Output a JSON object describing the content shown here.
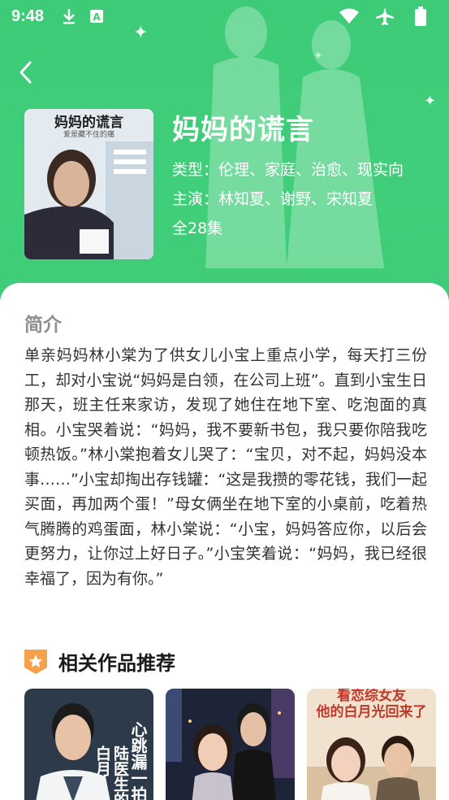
{
  "status_bar": {
    "time": "9:48",
    "left_icons": [
      "download-icon",
      "app-a-icon"
    ],
    "right_icons": [
      "wifi-icon",
      "airplane-icon",
      "battery-icon"
    ]
  },
  "header": {
    "back_icon": "chevron-left-icon"
  },
  "drama": {
    "title": "妈妈的谎言",
    "genre": "类型：伦理、家庭、治愈、现实向",
    "cast": "主演：林知夏、谢野、宋知夏",
    "episodes": "全28集",
    "poster": {
      "title": "妈妈的谎言",
      "subtitle": "爱是藏不住的痛"
    }
  },
  "synopsis": {
    "heading": "简介",
    "text": "单亲妈妈林小棠为了供女儿小宝上重点小学，每天打三份工，却对小宝说“妈妈是白领，在公司上班”。直到小宝生日那天，班主任来家访，发现了她住在地下室、吃泡面的真相。小宝哭着说：“妈妈，我不要新书包，我只要你陪我吃顿热饭。”林小棠抱着女儿哭了：“宝贝，对不起，妈妈没本事……”小宝却掏出存钱罐：“这是我攒的零花钱，我们一起买面，再加两个蛋！”母女俩坐在地下室的小桌前，吃着热气腾腾的鸡蛋面，林小棠说：“小宝，妈妈答应你，以后会更努力，让你过上好日子。”小宝笑着说：“妈妈，我已经很幸福了，因为有你。”"
  },
  "recommendations": {
    "heading": "相关作品推荐",
    "badge_icon": "star-badge-icon",
    "items": [
      {
        "overlay_text": "心跳漏一拍",
        "overlay_text2": "陆医生的白月"
      },
      {
        "overlay_text": ""
      },
      {
        "overlay_text": "他的白月光回来了",
        "top_text": "看恋综女友"
      }
    ]
  },
  "colors": {
    "hero_green": "#3ecb78",
    "badge_orange": "#f5a04a",
    "text_dark": "#333333",
    "text_gray": "#8e8e8e"
  }
}
